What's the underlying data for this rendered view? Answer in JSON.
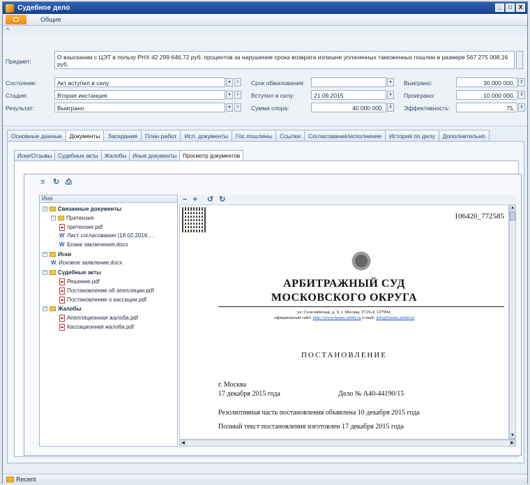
{
  "window": {
    "title": "Судебное дело",
    "buttons": [
      "_",
      "□",
      "X"
    ]
  },
  "menu": {
    "tab": "Общие"
  },
  "collapse_icon": "^",
  "form": {
    "subject_label": "Предмет:",
    "subject_value": "О взыскании с ЦЭТ в пользу РНХ 42 299 646,72 руб. процентов за нарушение срока возврата излишне уплаченных таможенных пошлин в размере 567 275 008,16 руб.",
    "state_label": "Состояние:",
    "state_value": "Акт вступил в силу",
    "stage_label": "Стадия:",
    "stage_value": "Вторая инстанция",
    "result_label": "Результат:",
    "result_value": "Выиграно",
    "appeal_label": "Срок обжалования:",
    "appeal_value": "",
    "effective_label": "Вступил в силу:",
    "effective_value": "21.09.2015",
    "claim_label": "Сумма спора:",
    "claim_value": "40 000 000,",
    "won_label": "Выиграно:",
    "won_value": "30 000 000,",
    "lost_label": "Проиграно:",
    "lost_value": "10 000 000,",
    "eff_label": "Эффективность:",
    "eff_value": "75,"
  },
  "tabs": [
    "Основные данные",
    "Документы",
    "Заседания",
    "План работ",
    "Исп. документы",
    "Гос.пошлины",
    "Ссылки",
    "Согласование/исполнение",
    "История по делу",
    "Дополнительно"
  ],
  "subtabs": [
    "Иски/Отзывы",
    "Судебные акты",
    "Жалобы",
    "Иные документы",
    "Просмотр документов"
  ],
  "tree": {
    "header": "Имя",
    "nodes": [
      {
        "label": "Связанные документы",
        "type": "folder",
        "bold": true
      },
      {
        "label": "Претензия",
        "type": "folder",
        "bold": false
      },
      {
        "label": "претензия.pdf",
        "type": "pdf",
        "bold": false
      },
      {
        "label": "Лист согласования (18.02.2016 ...",
        "type": "word",
        "bold": false
      },
      {
        "label": "Бланк заключения.docx",
        "type": "word",
        "bold": false
      },
      {
        "label": "Иски",
        "type": "folder",
        "bold": true
      },
      {
        "label": "Исковое заявление.docx",
        "type": "word",
        "bold": false
      },
      {
        "label": "Судебные акты",
        "type": "folder",
        "bold": true
      },
      {
        "label": "Решение.pdf",
        "type": "pdf",
        "bold": false
      },
      {
        "label": "Постановление об апелляции.pdf",
        "type": "pdf",
        "bold": false
      },
      {
        "label": "Постановление о кассации.pdf",
        "type": "pdf",
        "bold": false
      },
      {
        "label": "Жалобы",
        "type": "folder",
        "bold": true
      },
      {
        "label": "Апелляционная жалоба.pdf",
        "type": "pdf",
        "bold": false
      },
      {
        "label": "Кассационная жалоба.pdf",
        "type": "pdf",
        "bold": false
      }
    ]
  },
  "doc": {
    "number": "106420_772585",
    "court_line1": "АРБИТРАЖНЫЙ СУД",
    "court_line2": "МОСКОВСКОГО ОКРУГА",
    "address": "ул. Селезнёвская, д. 9, г. Москва, ГСП-4, 127994,",
    "site_prefix": "официальный сайт:",
    "site_link": "http://www.fasmo.arbitr.ru",
    "email_prefix": "e-mail:",
    "email_link": "info@fasmo.arbitr.ru",
    "title": "ПОСТАНОВЛЕНИЕ",
    "city": "г. Москва",
    "date": "17 декабря 2015 года",
    "case": "Дело № А40-44190/15",
    "line1": "Резолютивная часть постановления объявлена 10 декабря 2015 года",
    "line2": "Полный текст постановления изготовлен  17 декабря 2015 года"
  },
  "status": {
    "recent": "Recent"
  }
}
